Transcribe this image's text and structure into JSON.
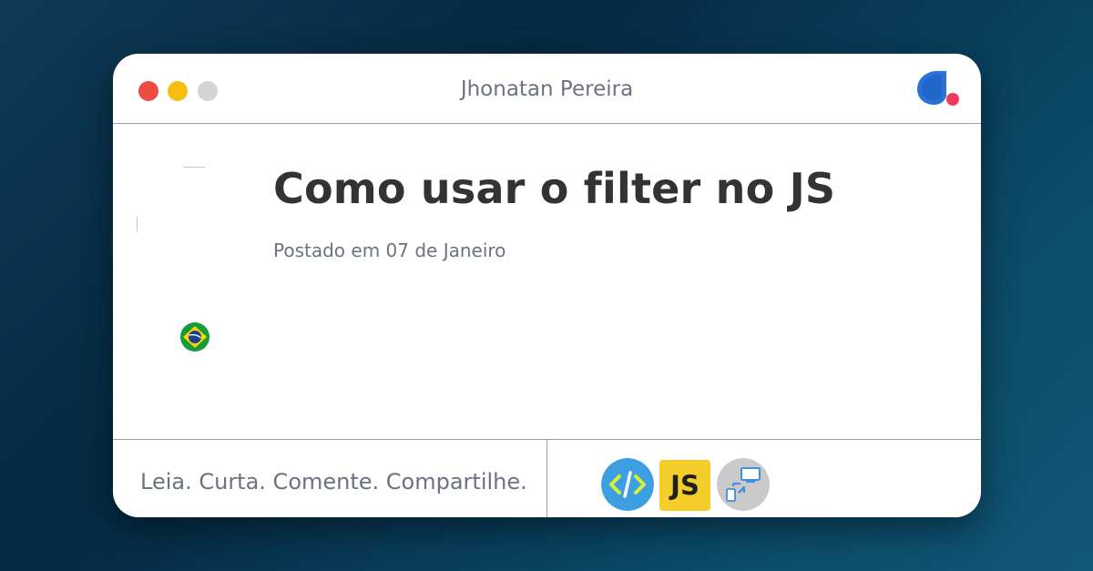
{
  "window": {
    "author": "Jhonatan Pereira",
    "controls": {
      "close_color": "#f04a44",
      "minimize_color": "#f7be12",
      "maximize_color": "#d4d4d4"
    },
    "logo": {
      "icon": "dio-logo-icon",
      "primary_color": "#2a72d6",
      "accent_color": "#ee3a5c"
    }
  },
  "post": {
    "title": "Como usar o filter no JS",
    "date": "Postado em 07 de Janeiro",
    "flag_icon": "brazil-flag-icon"
  },
  "footer": {
    "tagline": "Leia. Curta. Comente. Compartilhe.",
    "tech_icons": [
      {
        "name": "code-icon",
        "bg": "#3d9ee2",
        "fg": "#d8f038"
      },
      {
        "name": "javascript-icon",
        "label": "JS",
        "bg": "#f5cd2b"
      },
      {
        "name": "tools-icon",
        "bg": "#c9c9c9",
        "fg": "#3e8fe0"
      }
    ]
  }
}
